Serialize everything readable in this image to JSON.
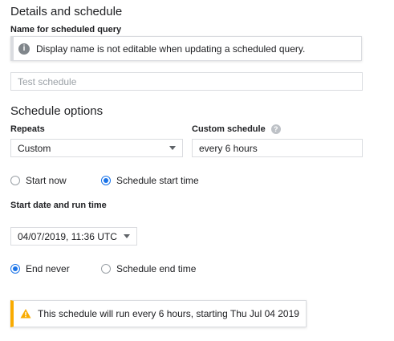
{
  "header": {
    "title": "Details and schedule"
  },
  "name_section": {
    "label": "Name for scheduled query",
    "info_message": "Display name is not editable when updating a scheduled query.",
    "name_placeholder": "Test schedule"
  },
  "schedule_options": {
    "title": "Schedule options",
    "repeats_label": "Repeats",
    "repeats_value": "Custom",
    "custom_schedule_label": "Custom schedule",
    "custom_schedule_value": "every 6 hours"
  },
  "start": {
    "start_now_label": "Start now",
    "schedule_start_label": "Schedule start time",
    "selected": "schedule_start_time",
    "datetime_label": "Start date and run time",
    "datetime_value": "04/07/2019, 11:36 UTC"
  },
  "end": {
    "end_never_label": "End never",
    "schedule_end_label": "Schedule end time",
    "selected": "end_never"
  },
  "warning": {
    "message": "This schedule will run every 6 hours, starting Thu Jul 04 2019"
  },
  "colors": {
    "accent": "#1a73e8",
    "warning": "#f9ab00",
    "border": "#dadce0"
  },
  "icons": [
    "info-icon",
    "help-icon",
    "chevron-down-icon",
    "warning-icon"
  ]
}
